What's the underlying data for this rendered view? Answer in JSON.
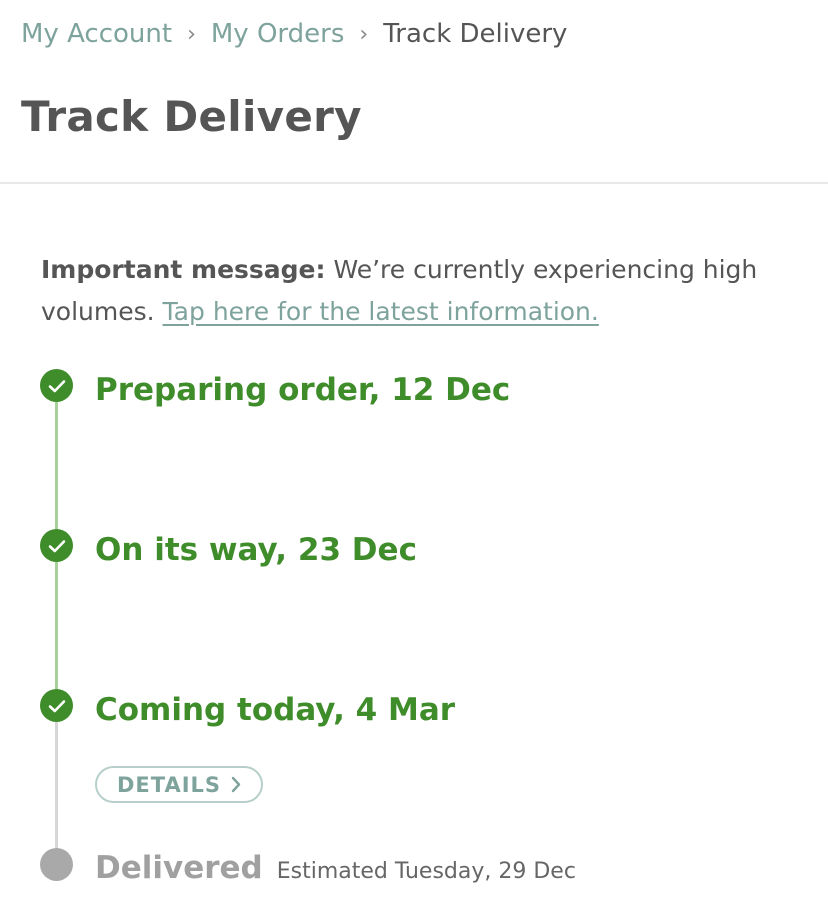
{
  "breadcrumb": {
    "items": [
      {
        "label": "My Account"
      },
      {
        "label": "My Orders"
      },
      {
        "label": "Track Delivery"
      }
    ],
    "separator": "›"
  },
  "page": {
    "title": "Track Delivery"
  },
  "notice": {
    "label": "Important message:",
    "text": " We’re currently experiencing high volumes. ",
    "link_text": "Tap here for the latest information."
  },
  "timeline": {
    "steps": [
      {
        "title": "Preparing order, 12 Dec",
        "status": "complete",
        "icon": "check-icon"
      },
      {
        "title": "On its way, 23 Dec",
        "status": "complete",
        "icon": "check-icon"
      },
      {
        "title": "Coming today, 4 Mar",
        "status": "complete",
        "icon": "check-icon",
        "action_label": "DETAILS"
      },
      {
        "title": "Delivered",
        "status": "pending",
        "estimate": "Estimated Tuesday, 29 Dec"
      }
    ]
  },
  "colors": {
    "complete": "#3f8c2a",
    "complete_line": "#a7d19a",
    "pending": "#a9a9a9",
    "link": "#7ea39c",
    "text": "#555555"
  }
}
